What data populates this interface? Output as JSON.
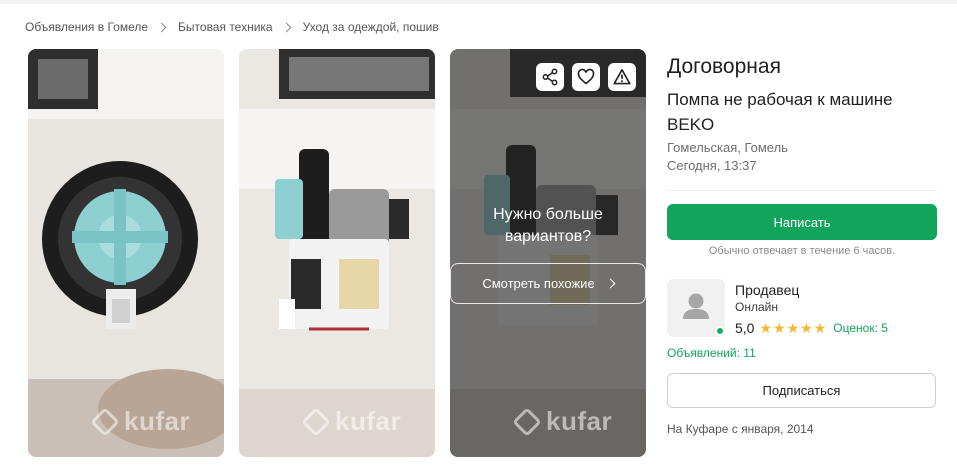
{
  "breadcrumb": [
    "Объявления в Гомеле",
    "Бытовая техника",
    "Уход за одеждой, пошив"
  ],
  "gallery": {
    "watermark": "kufar",
    "more_title": "Нужно больше вариантов?",
    "more_button": "Смотреть похожие",
    "actions": [
      "share-icon",
      "heart-icon",
      "warning-icon"
    ]
  },
  "listing": {
    "price": "Договорная",
    "title": "Помпа не рабочая к машине BEKO",
    "location": "Гомельская, Гомель",
    "posted": "Сегодня, 13:37"
  },
  "contact": {
    "write_button": "Написать",
    "reply_note": "Обычно отвечает в течение 6 часов."
  },
  "seller": {
    "label": "Продавец",
    "status": "Онлайн",
    "rating": "5,0",
    "stars": 5,
    "reviews": "Оценок: 5",
    "ads_count": "Объявлений: 11",
    "subscribe_button": "Подписаться",
    "since": "На Куфаре с января, 2014"
  },
  "colors": {
    "accent": "#10a55a",
    "star": "#f5b82e",
    "online": "#12b05c"
  }
}
